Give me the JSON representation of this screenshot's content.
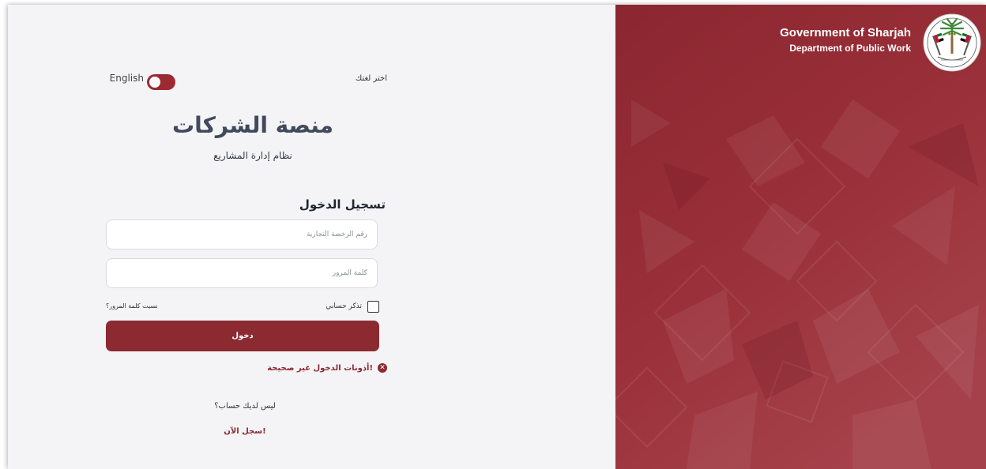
{
  "language": {
    "choose_label": "اختر لغتك",
    "option_label": "English",
    "toggle_on": true
  },
  "platform": {
    "title": "منصة الشركات",
    "subtitle": "نظام إدارة المشاريع"
  },
  "login": {
    "heading": "تسجيل الدخول",
    "license_placeholder": "رقم الرخصة التجارية",
    "password_placeholder": "كلمة المرور",
    "remember_label": "تذكر حسابي",
    "forgot_label": "نسيت كلمة المرور؟",
    "submit_label": "دخول",
    "error_message": "أذونات الدخول غير صحيحة!",
    "no_account_text": "ليس لديك حساب؟",
    "register_label": "سجل الآن!"
  },
  "branding": {
    "line1": "Government of Sharjah",
    "line2": "Department of Public Work",
    "emblem_icon": "sharjah-emblem-icon"
  },
  "colors": {
    "brand": "#8b2a31",
    "panel_bg": "#8f2933",
    "left_bg": "#f4f4f6"
  }
}
